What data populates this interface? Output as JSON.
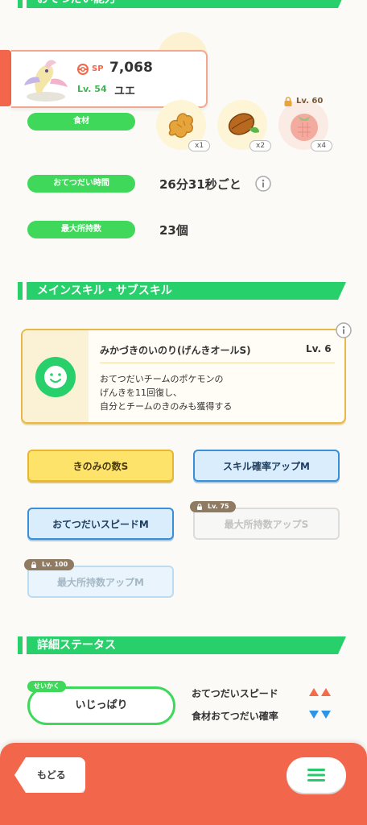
{
  "top_section": {
    "title": "おてつだい能力"
  },
  "pokemon_card": {
    "sp_label": "SP",
    "sp_value": "7,068",
    "level": "Lv. 54",
    "name": "ユエ"
  },
  "ingredients": {
    "label": "食材",
    "items": [
      {
        "name": "ginger",
        "icon": "ginger-icon",
        "qty": "x1"
      },
      {
        "name": "cacao",
        "icon": "cacao-icon",
        "qty": "x2"
      },
      {
        "name": "tomato",
        "icon": "tomato-icon",
        "qty": "x4",
        "locked": true,
        "unlock_level": "Lv. 60"
      }
    ]
  },
  "help_time": {
    "label": "おてつだい時間",
    "value": "26分31秒ごと"
  },
  "max_carry": {
    "label": "最大所持数",
    "value": "23個"
  },
  "skills_section": {
    "title": "メインスキル・サブスキル",
    "main_skill": {
      "name": "みかづきのいのり(げんきオールS)",
      "level": "Lv. 6",
      "desc_line1": "おてつだいチームのポケモンの",
      "desc_line2": "げんきを11回復し、",
      "desc_line3": "自分とチームのきのみも獲得する"
    },
    "sub_skills": [
      {
        "label": "きのみの数S",
        "style": "gold"
      },
      {
        "label": "スキル確率アップM",
        "style": "blue"
      },
      {
        "label": "おてつだいスピードM",
        "style": "blue"
      },
      {
        "label": "最大所持数アップS",
        "style": "locked",
        "unlock_level": "Lv. 75"
      },
      {
        "label": "最大所持数アップM",
        "style": "locked-blue",
        "unlock_level": "Lv. 100"
      }
    ]
  },
  "detail_section": {
    "title": "詳細ステータス",
    "nature_tag": "せいかく",
    "nature": "いじっぱり",
    "stat_up": "おてつだいスピード",
    "stat_down": "食材おてつだい確率"
  },
  "footer": {
    "back_label": "もどる",
    "menu_icon": "menu-icon"
  },
  "colors": {
    "green": "#27d06a",
    "orange": "#f2674b",
    "up_red": "#f26b4b",
    "down_blue": "#2e95e6"
  }
}
